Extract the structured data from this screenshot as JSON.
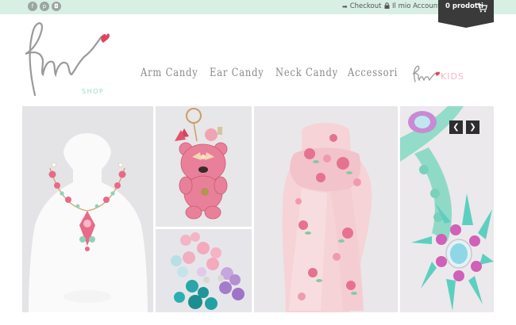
{
  "social": [
    {
      "icon": "facebook-icon",
      "glyph": "f"
    },
    {
      "icon": "pinterest-icon",
      "glyph": "p"
    },
    {
      "icon": "instagram-icon",
      "glyph": "◘"
    }
  ],
  "header": {
    "checkout_label": "Checkout",
    "account_label": "Il mio Account",
    "cart_label": "0 prodotti"
  },
  "logo": {
    "shop_label": "SHOP",
    "heart_color": "#e0435e",
    "mint_color": "#9ed9c4"
  },
  "nav": {
    "items": [
      {
        "label": "Arm Candy"
      },
      {
        "label": "Ear Candy"
      },
      {
        "label": "Neck Candy"
      },
      {
        "label": "Accessori"
      }
    ],
    "kids_label": "KIDS"
  },
  "slider": {
    "prev_glyph": "❮",
    "next_glyph": "❯"
  },
  "colors": {
    "topbar": "#d8efe4",
    "cart_bg": "#3a3a3a",
    "nav_text": "#8a8a8a"
  }
}
